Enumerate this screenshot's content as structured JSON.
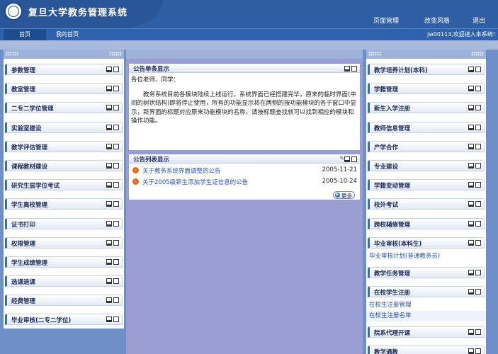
{
  "header": {
    "logo_text": "复旦",
    "title": "复旦大学教务管理系统",
    "nav": [
      "页面管理",
      "改变风格",
      "退出"
    ]
  },
  "navbar": {
    "tabs": [
      "首页",
      "我的首页"
    ],
    "welcome": "jw00113,欢迎进入本系统!"
  },
  "left_modules": [
    "参数管理",
    "教室管理",
    "二专二学位管理",
    "实验室建设",
    "教学评估管理",
    "课程教材建设",
    "研究生层学位考试",
    "学生离校管理",
    "证书打印",
    "权限管理",
    "学生成绩管理",
    "选课退课",
    "经费管理",
    "毕业审核(二专二学位)"
  ],
  "center": {
    "notice_single": {
      "title": "公告单条显示",
      "greeting": "各位老师、同学：",
      "body": "教务系统目前各模块陆续上线运行，系统界面已经搭建完毕，原来的临时界面(中间的树状结构)即将停止使用，所有的功能显示将在两侧的按功能模块的各子窗口中显示，新界面的标题对应原来功能模块的名称，请按标题查找就可以找到相应的模块和操作功能。"
    },
    "notice_list": {
      "title": "公告列表显示",
      "items": [
        {
          "text": "关于教务系统界面调整的公告",
          "date": "2005-11-21"
        },
        {
          "text": "关于2005级新生添加学生证信息的公告",
          "date": "2005-10-24"
        }
      ],
      "more_label": "更多"
    }
  },
  "right_items": [
    {
      "type": "module",
      "label": "教学培养计划(本科)"
    },
    {
      "type": "module",
      "label": "学籍管理"
    },
    {
      "type": "module",
      "label": "新生入学注册"
    },
    {
      "type": "module",
      "label": "教师信息管理"
    },
    {
      "type": "module",
      "label": "产学合作"
    },
    {
      "type": "module",
      "label": "专业建设"
    },
    {
      "type": "module",
      "label": "学籍变动管理"
    },
    {
      "type": "module",
      "label": "校外考试"
    },
    {
      "type": "module",
      "label": "跨校辅修管理"
    },
    {
      "type": "module",
      "label": "毕业审核(本科生)"
    },
    {
      "type": "link",
      "label": "毕业审核计划(普通教务员)"
    },
    {
      "type": "module",
      "label": "教学任务管理"
    },
    {
      "type": "module",
      "label": "在校学生注册"
    },
    {
      "type": "link",
      "label": "在校生注册管理"
    },
    {
      "type": "link",
      "label": "在校生注册名单",
      "alt": true
    },
    {
      "type": "module",
      "label": "院系代理开课"
    },
    {
      "type": "module",
      "label": "教学通教"
    }
  ]
}
